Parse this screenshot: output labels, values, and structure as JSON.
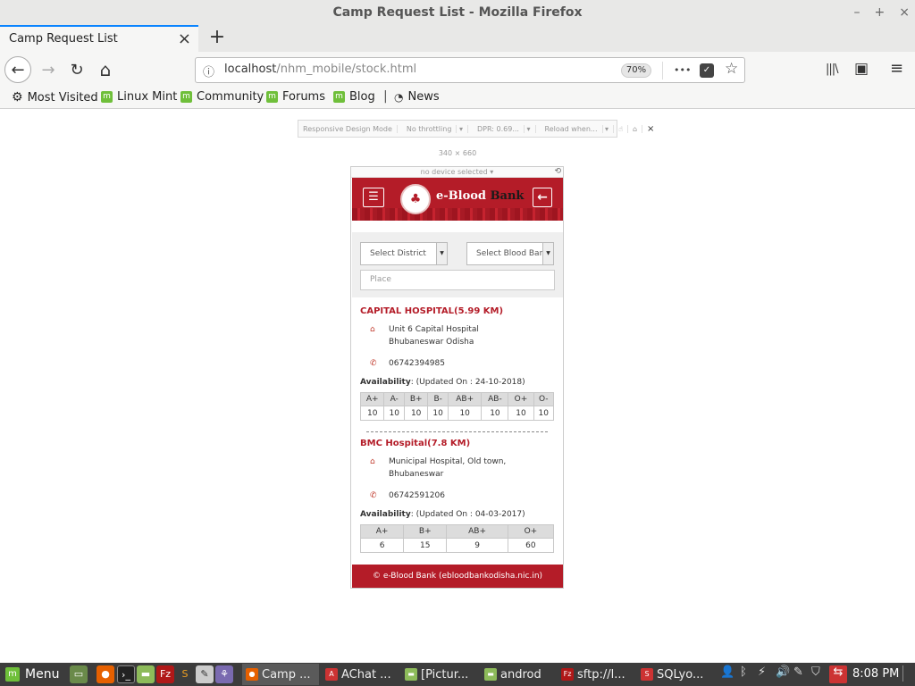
{
  "window": {
    "title": "Camp Request List - Mozilla Firefox",
    "minimize": "–",
    "maximize": "+",
    "close": "×"
  },
  "tab": {
    "label": "Camp Request List",
    "close": "×",
    "new_tab": "+"
  },
  "nav": {
    "back": "←",
    "forward": "→",
    "reload": "↻",
    "home": "⌂",
    "url_host": "localhost",
    "url_path": "/nhm_mobile/stock.html",
    "zoom": "70%",
    "more": "•••",
    "pocket": "✓",
    "star": "☆",
    "library": "|||\\",
    "sidebar": "▣",
    "menu": "≡"
  },
  "bookmarks": [
    {
      "label": "Most Visited",
      "icon": "gear-icon"
    },
    {
      "label": "Linux Mint",
      "icon": "mint-icon"
    },
    {
      "label": "Community",
      "icon": "mint-icon"
    },
    {
      "label": "Forums",
      "icon": "mint-icon"
    },
    {
      "label": "Blog",
      "icon": "mint-icon"
    },
    {
      "label": "News",
      "icon": "rss-icon"
    }
  ],
  "rdm": {
    "mode": "Responsive Design Mode",
    "throttling": "No throttling",
    "dpr": "DPR: 0.69...",
    "reload": "Reload when...",
    "size_w": "340",
    "size_x": "×",
    "size_h": "660",
    "device": "no device selected"
  },
  "app": {
    "brand_main": "e-Blood",
    "brand_accent": "Bank",
    "district_placeholder": "Select District",
    "bloodbank_placeholder": "Select Blood Bar",
    "place_placeholder": "Place",
    "availability_label": "Availability",
    "footer": "© e-Blood Bank (ebloodbankodisha.nic.in)",
    "hospitals": [
      {
        "name": "CAPITAL HOSPITAL(5.99 KM)",
        "address_line1": "Unit 6 Capital Hospital",
        "address_line2": "Bhubaneswar Odisha",
        "phone": "06742394985",
        "updated": ": (Updated On : 24-10-2018)",
        "groups": [
          "A+",
          "A-",
          "B+",
          "B-",
          "AB+",
          "AB-",
          "O+",
          "O-"
        ],
        "counts": [
          "10",
          "10",
          "10",
          "10",
          "10",
          "10",
          "10",
          "10"
        ]
      },
      {
        "name": "BMC Hospital(7.8 KM)",
        "address_line1": "Municipal Hospital, Old town,",
        "address_line2": "Bhubaneswar",
        "phone": "06742591206",
        "updated": ": (Updated On : 04-03-2017)",
        "groups": [
          "A+",
          "B+",
          "AB+",
          "O+"
        ],
        "counts": [
          "6",
          "15",
          "9",
          "60"
        ]
      }
    ]
  },
  "taskbar": {
    "menu": "Menu",
    "tasks": [
      {
        "label": "Camp ...",
        "active": true
      },
      {
        "label": "AChat ...",
        "active": false
      },
      {
        "label": "[Pictur...",
        "active": false
      },
      {
        "label": "androd",
        "active": false
      },
      {
        "label": "sftp://l...",
        "active": false
      },
      {
        "label": "SQLyo...",
        "active": false
      }
    ],
    "clock": "8:08 PM"
  },
  "colors": {
    "brand_red": "#b41c28",
    "taskbar": "#3c3c3c",
    "tab_accent": "#0a84ff"
  }
}
